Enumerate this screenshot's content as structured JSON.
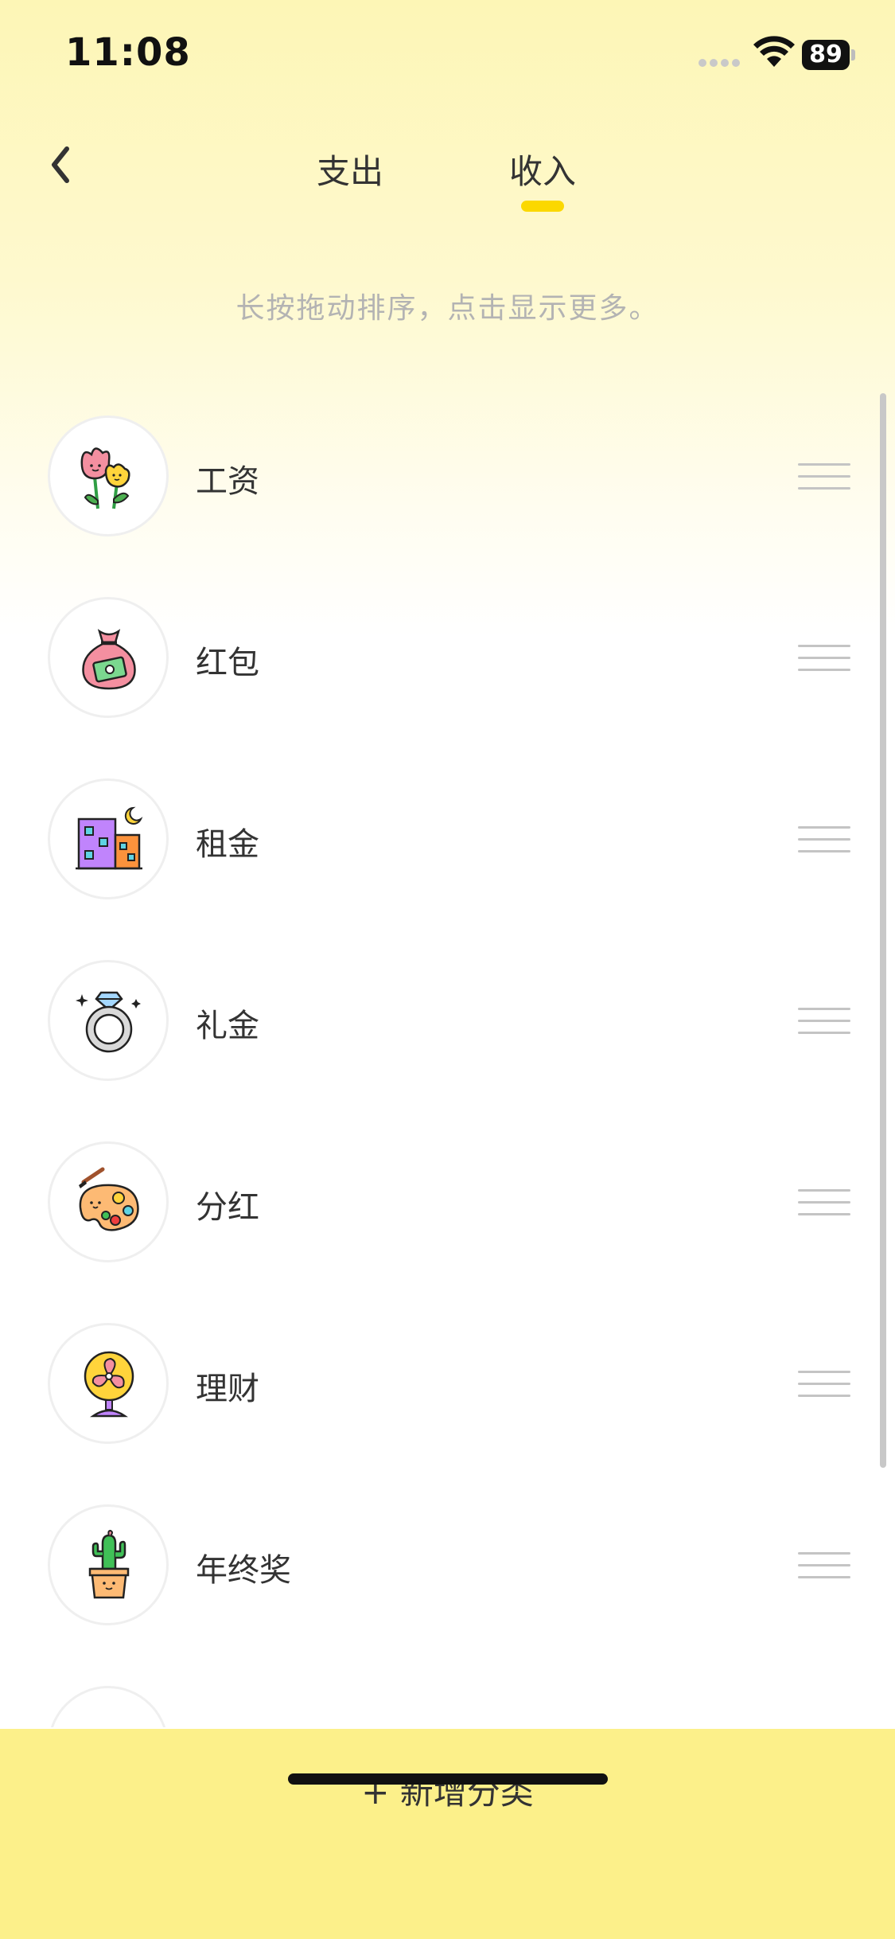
{
  "status_bar": {
    "time": "11:08",
    "battery": "89"
  },
  "header": {
    "back_icon": "chevron-left-icon",
    "tabs": [
      {
        "label": "支出",
        "active": false
      },
      {
        "label": "收入",
        "active": true
      }
    ],
    "indicator_color": "#fbd800"
  },
  "hint": "长按拖动排序，点击显示更多。",
  "categories": [
    {
      "label": "工资",
      "icon": "flowers-icon"
    },
    {
      "label": "红包",
      "icon": "money-bag-icon"
    },
    {
      "label": "租金",
      "icon": "buildings-icon"
    },
    {
      "label": "礼金",
      "icon": "ring-icon"
    },
    {
      "label": "分红",
      "icon": "palette-icon"
    },
    {
      "label": "理财",
      "icon": "fan-icon"
    },
    {
      "label": "年终奖",
      "icon": "cactus-icon"
    }
  ],
  "bottom": {
    "add_label": "+ 新增分类",
    "background": "#fcf08a"
  }
}
